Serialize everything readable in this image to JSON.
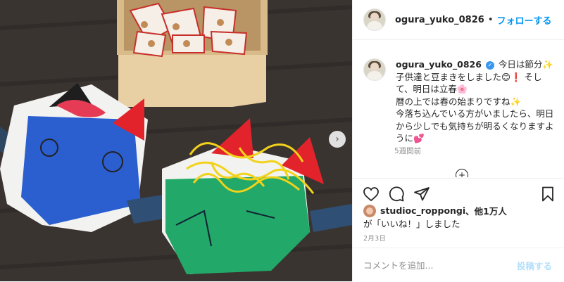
{
  "header": {
    "username": "ogura_yuko_0826",
    "dot": "•",
    "follow_label": "フォローする"
  },
  "caption": {
    "username": "ogura_yuko_0826",
    "verified_icon": "verified-badge-icon",
    "lines": [
      "今日は節分✨",
      "子供達と豆まきをしました😊❗ そして、明日は立春🌸",
      "暦の上では春の始まりですね✨",
      "今落ち込んでいる方がいましたら、明日から少しでも気持ちが明るくなりますように💕"
    ],
    "time_ago": "5週間前"
  },
  "actions": {
    "icons": [
      "heart-icon",
      "comment-icon",
      "share-icon",
      "bookmark-icon"
    ]
  },
  "likes": {
    "user": "studioc_roppongi",
    "others": "、他1万人",
    "suffix": "が「いいね！」しました"
  },
  "date": "2月3日",
  "comment": {
    "placeholder": "コメントを追加...",
    "post_label": "投稿する"
  },
  "colors": {
    "link_blue": "#0095f6",
    "post_disabled": "#b2dffc",
    "muted": "#8e8e8e",
    "verified": "#3897f0"
  },
  "media": {
    "next_icon": "chevron-right-icon"
  }
}
